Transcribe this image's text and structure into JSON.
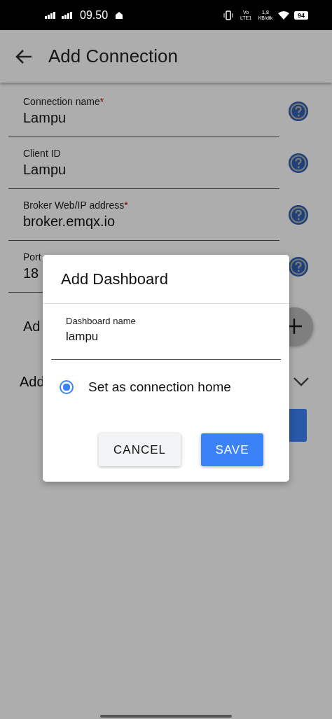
{
  "status_bar": {
    "time": "09.50",
    "volte": "Vo LTE1",
    "speed": "1,8 KB/dtk",
    "battery": "94"
  },
  "app_bar": {
    "title": "Add Connection"
  },
  "fields": [
    {
      "label": "Connection name",
      "mark": "*",
      "value": "Lampu"
    },
    {
      "label": "Client ID",
      "value": "Lampu"
    },
    {
      "label": "Broker Web/IP address",
      "mark": "*",
      "value": "broker.emqx.io"
    },
    {
      "label": "Port",
      "value": "18"
    }
  ],
  "sections": [
    {
      "label": "Ad",
      "kind": "add"
    },
    {
      "label": "Add",
      "kind": "expand"
    }
  ],
  "dialog": {
    "title": "Add Dashboard",
    "field": {
      "label": "Dashboard name",
      "value": "lampu"
    },
    "option": {
      "label": "Set as connection home",
      "selected": true
    },
    "buttons": [
      {
        "label": "CANCEL",
        "kind": "secondary"
      },
      {
        "label": "SAVE",
        "kind": "primary"
      }
    ]
  }
}
